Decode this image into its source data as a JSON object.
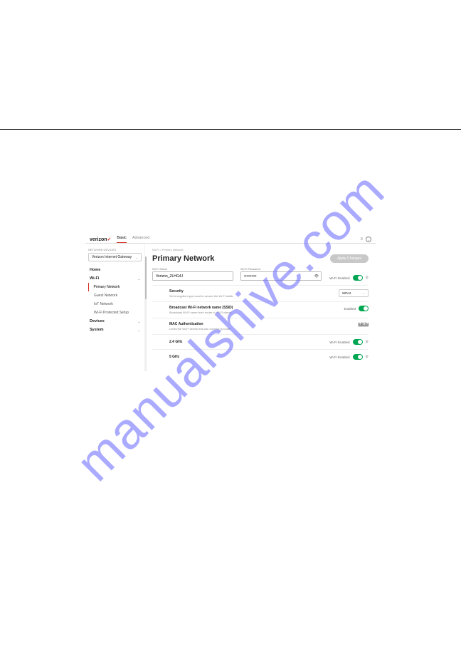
{
  "watermark": "manualshive.com",
  "header": {
    "logo": "verizon",
    "tabs": {
      "basic": "Basic",
      "advanced": "Advanced"
    }
  },
  "sidebar": {
    "network_devices_label": "NETWORK DEVICES",
    "gateway": "Verizon Internet Gateway",
    "home": "Home",
    "wifi": "Wi-Fi",
    "wifi_items": {
      "primary": "Primary Network",
      "guest": "Guest Network",
      "iot": "IoT Network",
      "wps": "Wi-Fi Protected Setup"
    },
    "devices": "Devices",
    "system": "System"
  },
  "breadcrumb": "Wi-Fi  >  Primary Network",
  "page_title": "Primary Network",
  "apply_button": "Apply Changes",
  "wifi_name": {
    "label": "Wi-Fi Name",
    "value": "Verizon_ZLHG4J"
  },
  "wifi_password": {
    "label": "Wi-Fi Password",
    "value": "●●●●●●●●●●"
  },
  "wifi_enabled_label": "Wi-Fi Enabled",
  "security": {
    "title": "Security",
    "desc": "Set encryption type used to secure the Wi-Fi traffic.",
    "value": "WPA2"
  },
  "broadcast": {
    "title": "Broadcast Wi-Fi network name (SSID)",
    "desc": "Broadcast Wi-Fi name from router to Wi-Fi clients.",
    "status": "Enabled"
  },
  "mac_auth": {
    "title": "MAC Authentication",
    "desc": "Limits the Wi-Fi clients that can connect to router.",
    "link": "Edit list"
  },
  "band24": {
    "label": "2.4 GHz",
    "status": "Wi-Fi Enabled"
  },
  "band5": {
    "label": "5 GHz",
    "status": "Wi-Fi Enabled"
  }
}
